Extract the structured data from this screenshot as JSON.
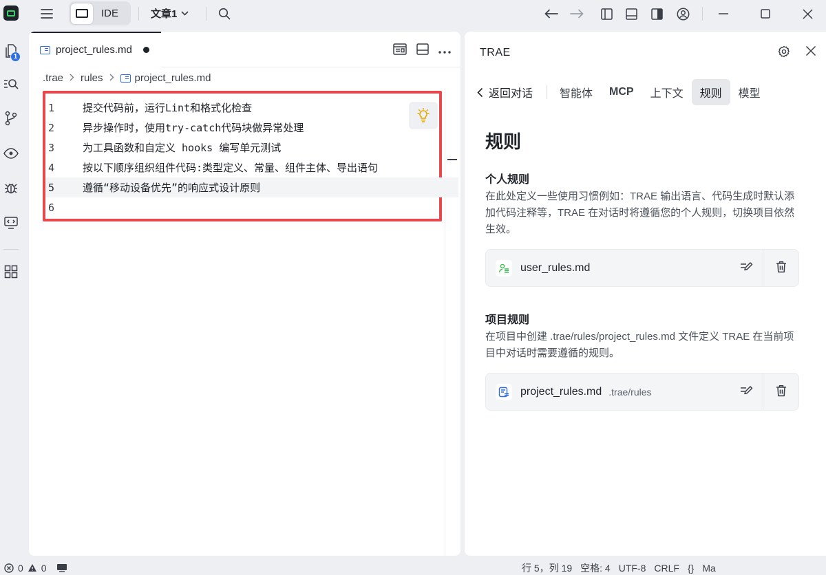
{
  "titlebar": {
    "mode_label": "IDE",
    "document_title": "文章1"
  },
  "activity": {
    "explorer_badge": "1"
  },
  "editor": {
    "tab": {
      "filename": "project_rules.md",
      "dirty": true
    },
    "breadcrumb": [
      ".trae",
      "rules",
      "project_rules.md"
    ],
    "lines": [
      {
        "number": "1",
        "text": "提交代码前，运行Lint和格式化检查"
      },
      {
        "number": "2",
        "text": "异步操作时，使用try-catch代码块做异常处理"
      },
      {
        "number": "3",
        "text": "为工具函数和自定义 hooks 编写单元测试"
      },
      {
        "number": "4",
        "text": "按以下顺序组织组件代码:类型定义、常量、组件主体、导出语句"
      },
      {
        "number": "5",
        "text": "遵循“移动设备优先”的响应式设计原则"
      },
      {
        "number": "6",
        "text": ""
      }
    ],
    "current_line": 5
  },
  "panel": {
    "title": "TRAE",
    "back_label": "返回对话",
    "tabs": [
      {
        "label": "智能体",
        "active": false
      },
      {
        "label": "MCP",
        "active": false
      },
      {
        "label": "上下文",
        "active": false
      },
      {
        "label": "规则",
        "active": true
      },
      {
        "label": "模型",
        "active": false
      }
    ],
    "heading": "规则",
    "personal": {
      "title": "个人规则",
      "description": "在此处定义一些使用习惯例如：TRAE 输出语言、代码生成时默认添加代码注释等，TRAE 在对话时将遵循您的个人规则，切换项目依然生效。",
      "file": {
        "name": "user_rules.md",
        "path": ""
      }
    },
    "project": {
      "title": "项目规则",
      "description": "在项目中创建 .trae/rules/project_rules.md 文件定义 TRAE 在当前项目中对话时需要遵循的规则。",
      "file": {
        "name": "project_rules.md",
        "path": ".trae/rules"
      }
    }
  },
  "statusbar": {
    "errors": "0",
    "warnings": "0",
    "cursor": "行 5，列 19",
    "spaces": "空格: 4",
    "encoding": "UTF-8",
    "eol": "CRLF",
    "braces": "{}",
    "language": "Ma"
  },
  "colors": {
    "accent_blue": "#2f6fe4",
    "highlight_red": "#e5484d",
    "logo_green": "#32d46a",
    "user_rule_green": "#3fb950"
  }
}
